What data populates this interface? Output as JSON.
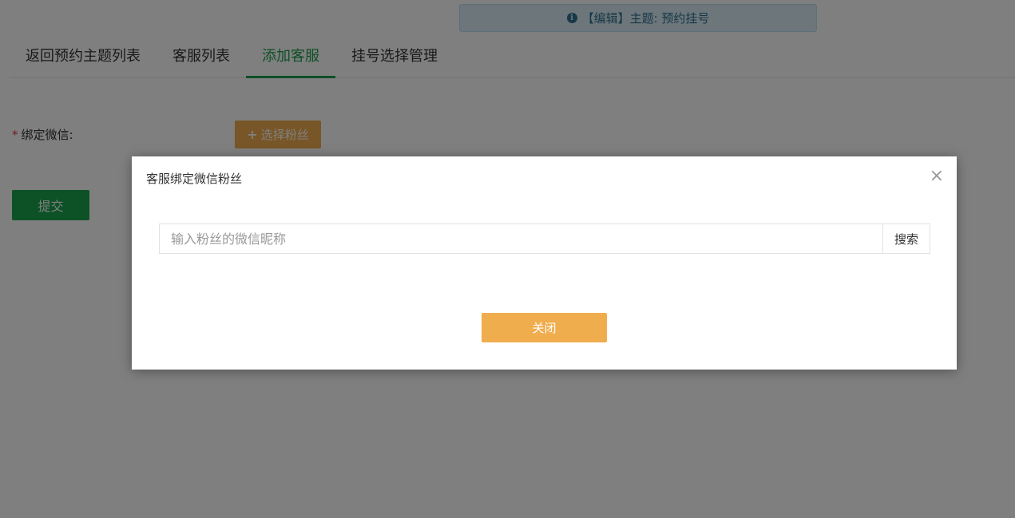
{
  "notice": {
    "icon": "info-circle-icon",
    "text": "【编辑】主题: 预约挂号",
    "color": "#31708f"
  },
  "tabs": [
    {
      "label": "返回预约主题列表",
      "active": false
    },
    {
      "label": "客服列表",
      "active": false
    },
    {
      "label": "添加客服",
      "active": true
    },
    {
      "label": "挂号选择管理",
      "active": false
    }
  ],
  "form": {
    "required_mark": "*",
    "bind_wechat_label": "绑定微信:",
    "select_fans_label": "选择粉丝",
    "submit_label": "提交"
  },
  "modal": {
    "title": "客服绑定微信粉丝",
    "close_glyph": "×",
    "search_placeholder": "输入粉丝的微信昵称",
    "search_value": "",
    "search_button": "搜索",
    "close_button": "关闭"
  },
  "colors": {
    "accent_green": "#1e9f4e",
    "warning_orange": "#f0ad4e"
  }
}
